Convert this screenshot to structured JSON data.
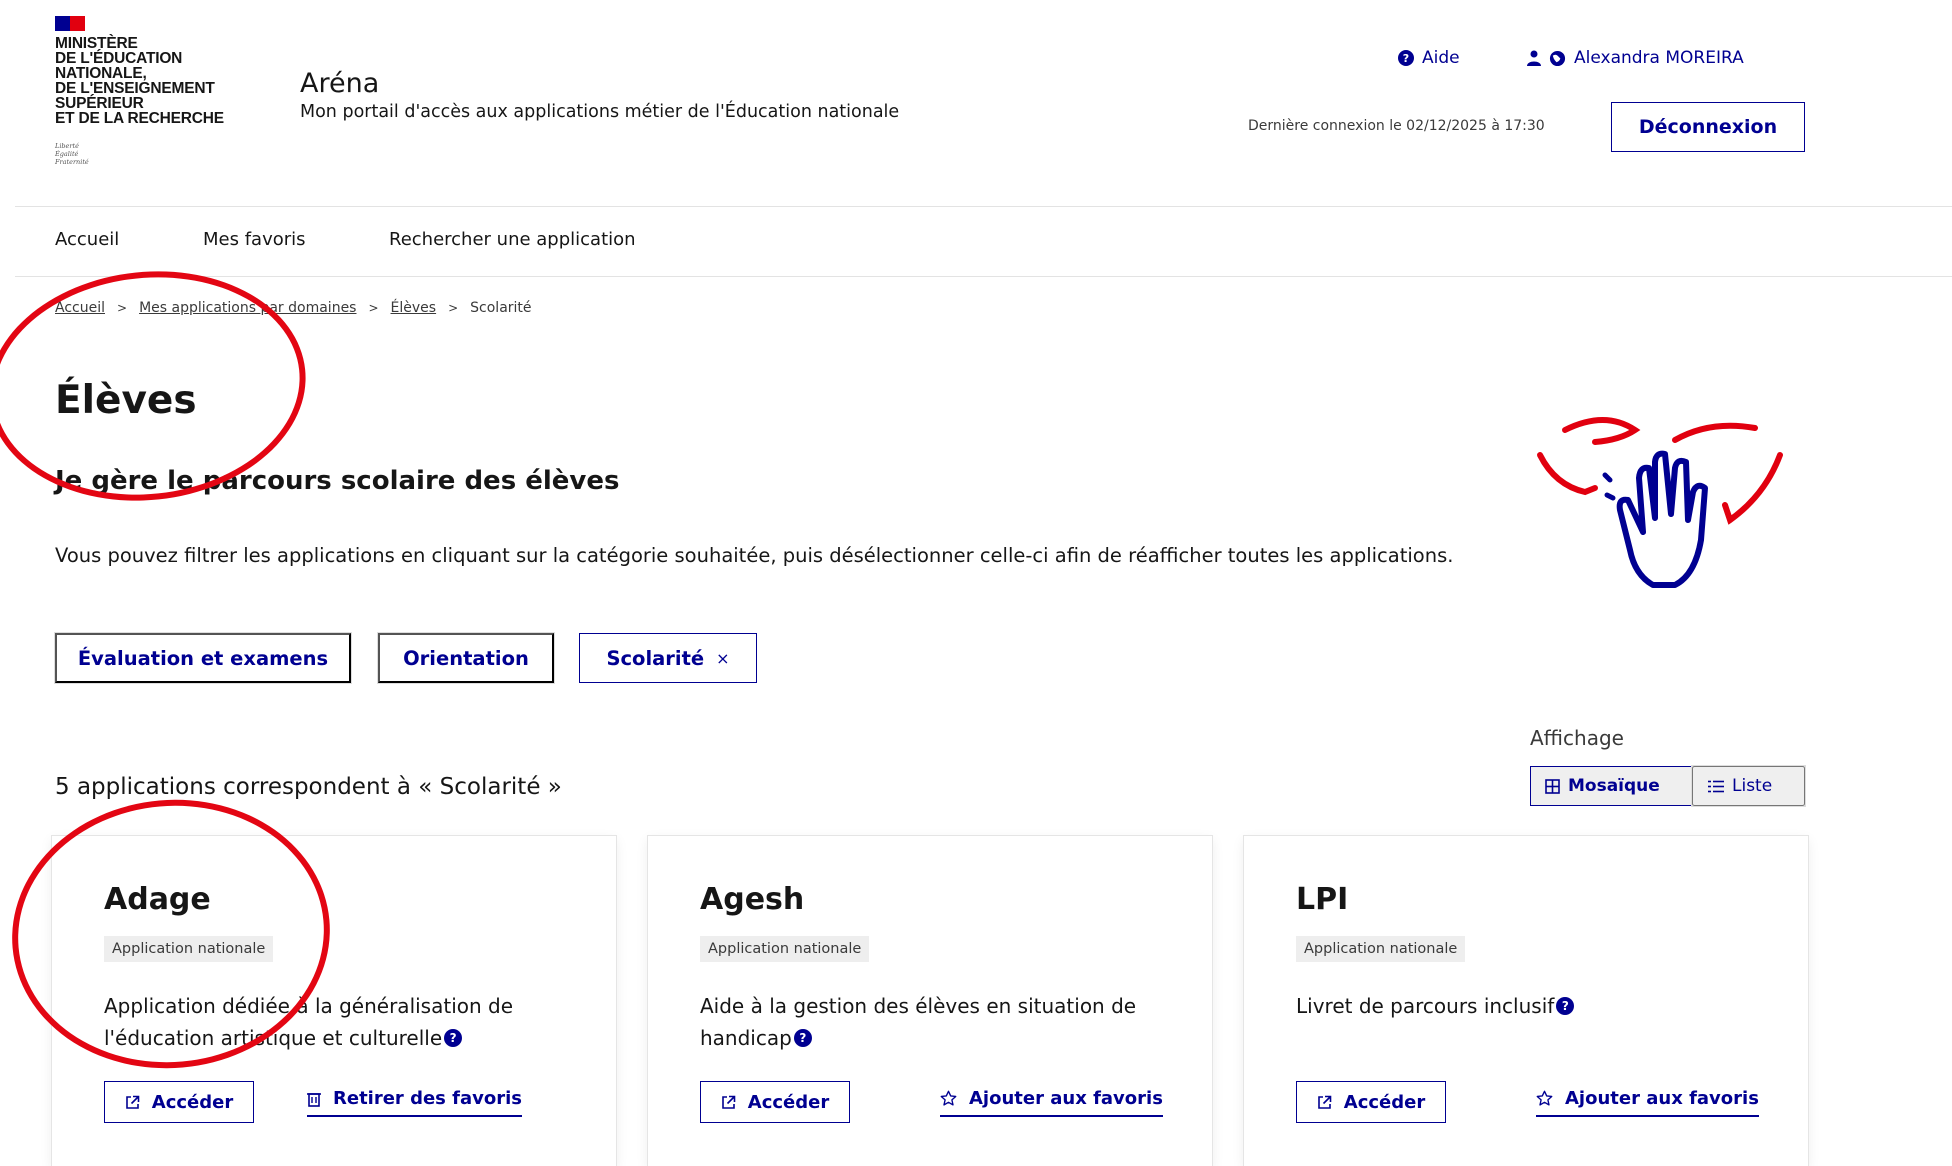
{
  "header": {
    "ministry_lines": [
      "MINISTÈRE",
      "DE L'ÉDUCATION",
      "NATIONALE,",
      "DE L'ENSEIGNEMENT",
      "SUPÉRIEUR",
      "ET DE LA RECHERCHE"
    ],
    "devise_lines": [
      "Liberté",
      "Égalité",
      "Fraternité"
    ],
    "site_title": "Aréna",
    "site_tagline": "Mon portail d'accès aux applications métier de l'Éducation nationale",
    "help_label": "Aide",
    "user_name": "Alexandra MOREIRA",
    "last_login": "Dernière connexion le 02/12/2025 à 17:30",
    "logout_label": "Déconnexion",
    "colors": {
      "brand_blue": "#000091",
      "marianne_red": "#e1000f"
    }
  },
  "nav": {
    "items": [
      {
        "label": "Accueil"
      },
      {
        "label": "Mes favoris"
      },
      {
        "label": "Rechercher une application"
      }
    ]
  },
  "breadcrumb": {
    "items": [
      "Accueil",
      "Mes applications par domaines",
      "Élèves"
    ],
    "current": "Scolarité",
    "separator": ">"
  },
  "page": {
    "title": "Élèves",
    "subtitle": "Je gère le parcours scolaire des élèves",
    "description": "Vous pouvez filtrer les applications en cliquant sur la catégorie souhaitée, puis désélectionner celle-ci afin de réafficher toutes les applications."
  },
  "filters": {
    "tags": [
      {
        "label": "Évaluation et examens",
        "selected": false
      },
      {
        "label": "Orientation",
        "selected": false
      },
      {
        "label": "Scolarité",
        "selected": true,
        "remove_glyph": "×"
      }
    ]
  },
  "results": {
    "count_text": "5 applications correspondent à « Scolarité »",
    "display_label": "Affichage",
    "mosaic_label": "Mosaïque",
    "list_label": "Liste",
    "selected_view": "Mosaïque"
  },
  "cards": [
    {
      "title": "Adage",
      "badge": "Application nationale",
      "description": "Application dédiée à la généralisation de l'éducation artistique et culturelle",
      "access_label": "Accéder",
      "favorite_label": "Retirer des favoris",
      "favorite_icon": "trash-icon"
    },
    {
      "title": "Agesh",
      "badge": "Application nationale",
      "description": "Aide à la gestion des élèves en situation de handicap",
      "access_label": "Accéder",
      "favorite_label": "Ajouter aux favoris",
      "favorite_icon": "star-icon"
    },
    {
      "title": "LPI",
      "badge": "Application nationale",
      "description": "Livret de parcours inclusif",
      "access_label": "Accéder",
      "favorite_label": "Ajouter aux favoris",
      "favorite_icon": "star-icon"
    }
  ],
  "annotations": {
    "circle_color": "#e30613"
  }
}
